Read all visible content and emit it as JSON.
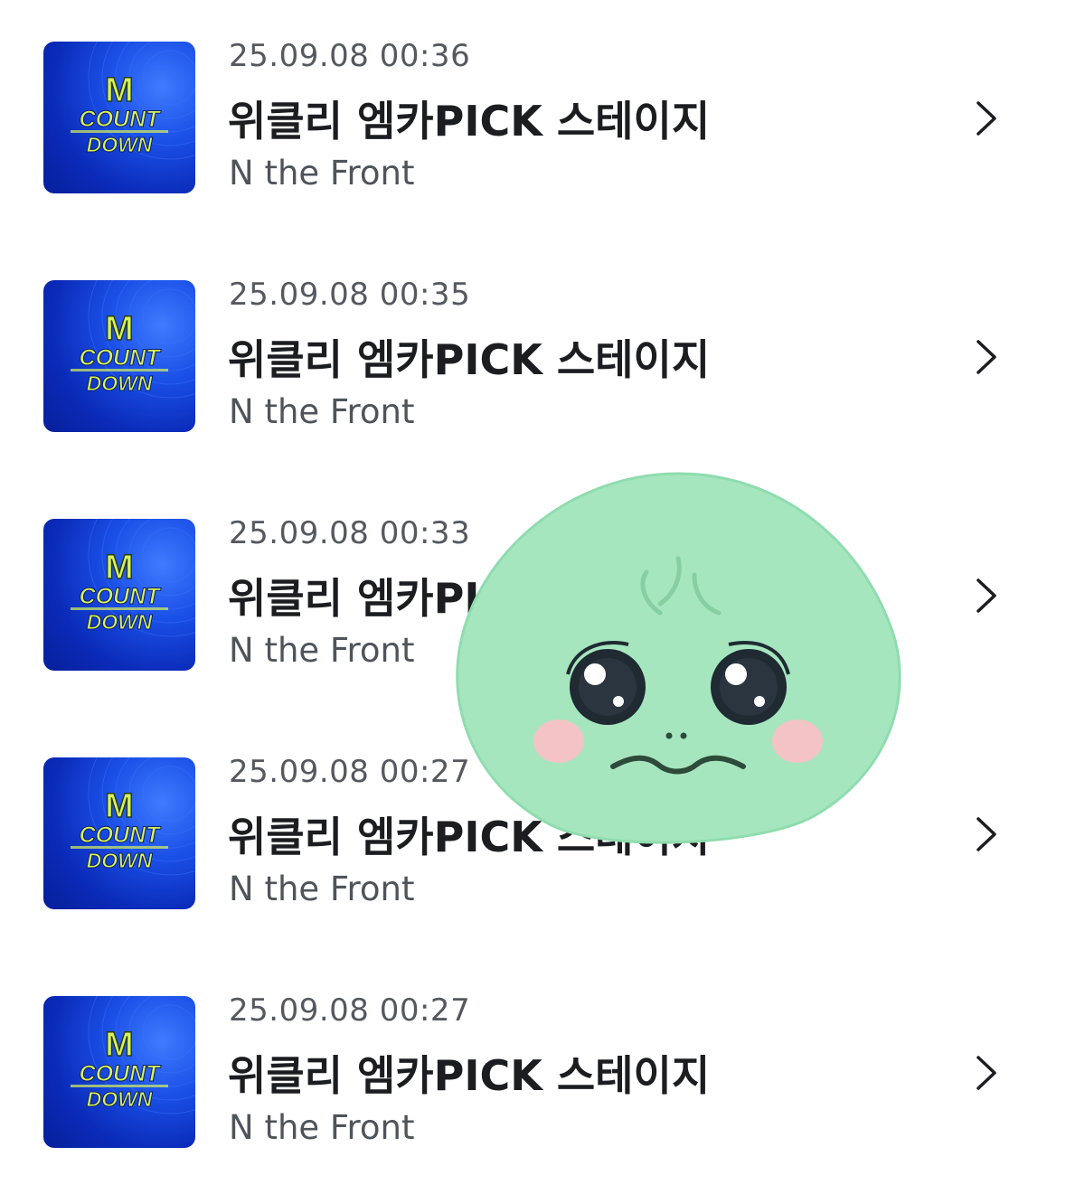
{
  "list": {
    "items": [
      {
        "date": "25.09.08 00:36",
        "title": "위클리 엠카PICK 스테이지",
        "artist": "N the Front"
      },
      {
        "date": "25.09.08 00:35",
        "title": "위클리 엠카PICK 스테이지",
        "artist": "N the Front"
      },
      {
        "date": "25.09.08 00:33",
        "title": "위클리 엠카PICK 스테이지",
        "artist": "N the Front"
      },
      {
        "date": "25.09.08 00:27",
        "title": "위클리 엠카PICK 스테이지",
        "artist": "N the Front"
      },
      {
        "date": "25.09.08 00:27",
        "title": "위클리 엠카PICK 스테이지",
        "artist": "N the Front"
      }
    ]
  },
  "thumbnail": {
    "logo_m": "M",
    "logo_line1": "COUNT",
    "logo_line2": "DOWN",
    "icon": "m-countdown-logo"
  },
  "icons": {
    "chevron": "chevron-right-icon",
    "sticker": "green-blob-face-sticker"
  },
  "colors": {
    "thumb_blue": "#0a2ab8",
    "logo_yellow": "#d8f35a",
    "sticker_green": "#a6e6bf",
    "cheek_pink": "#f3c3c6"
  }
}
